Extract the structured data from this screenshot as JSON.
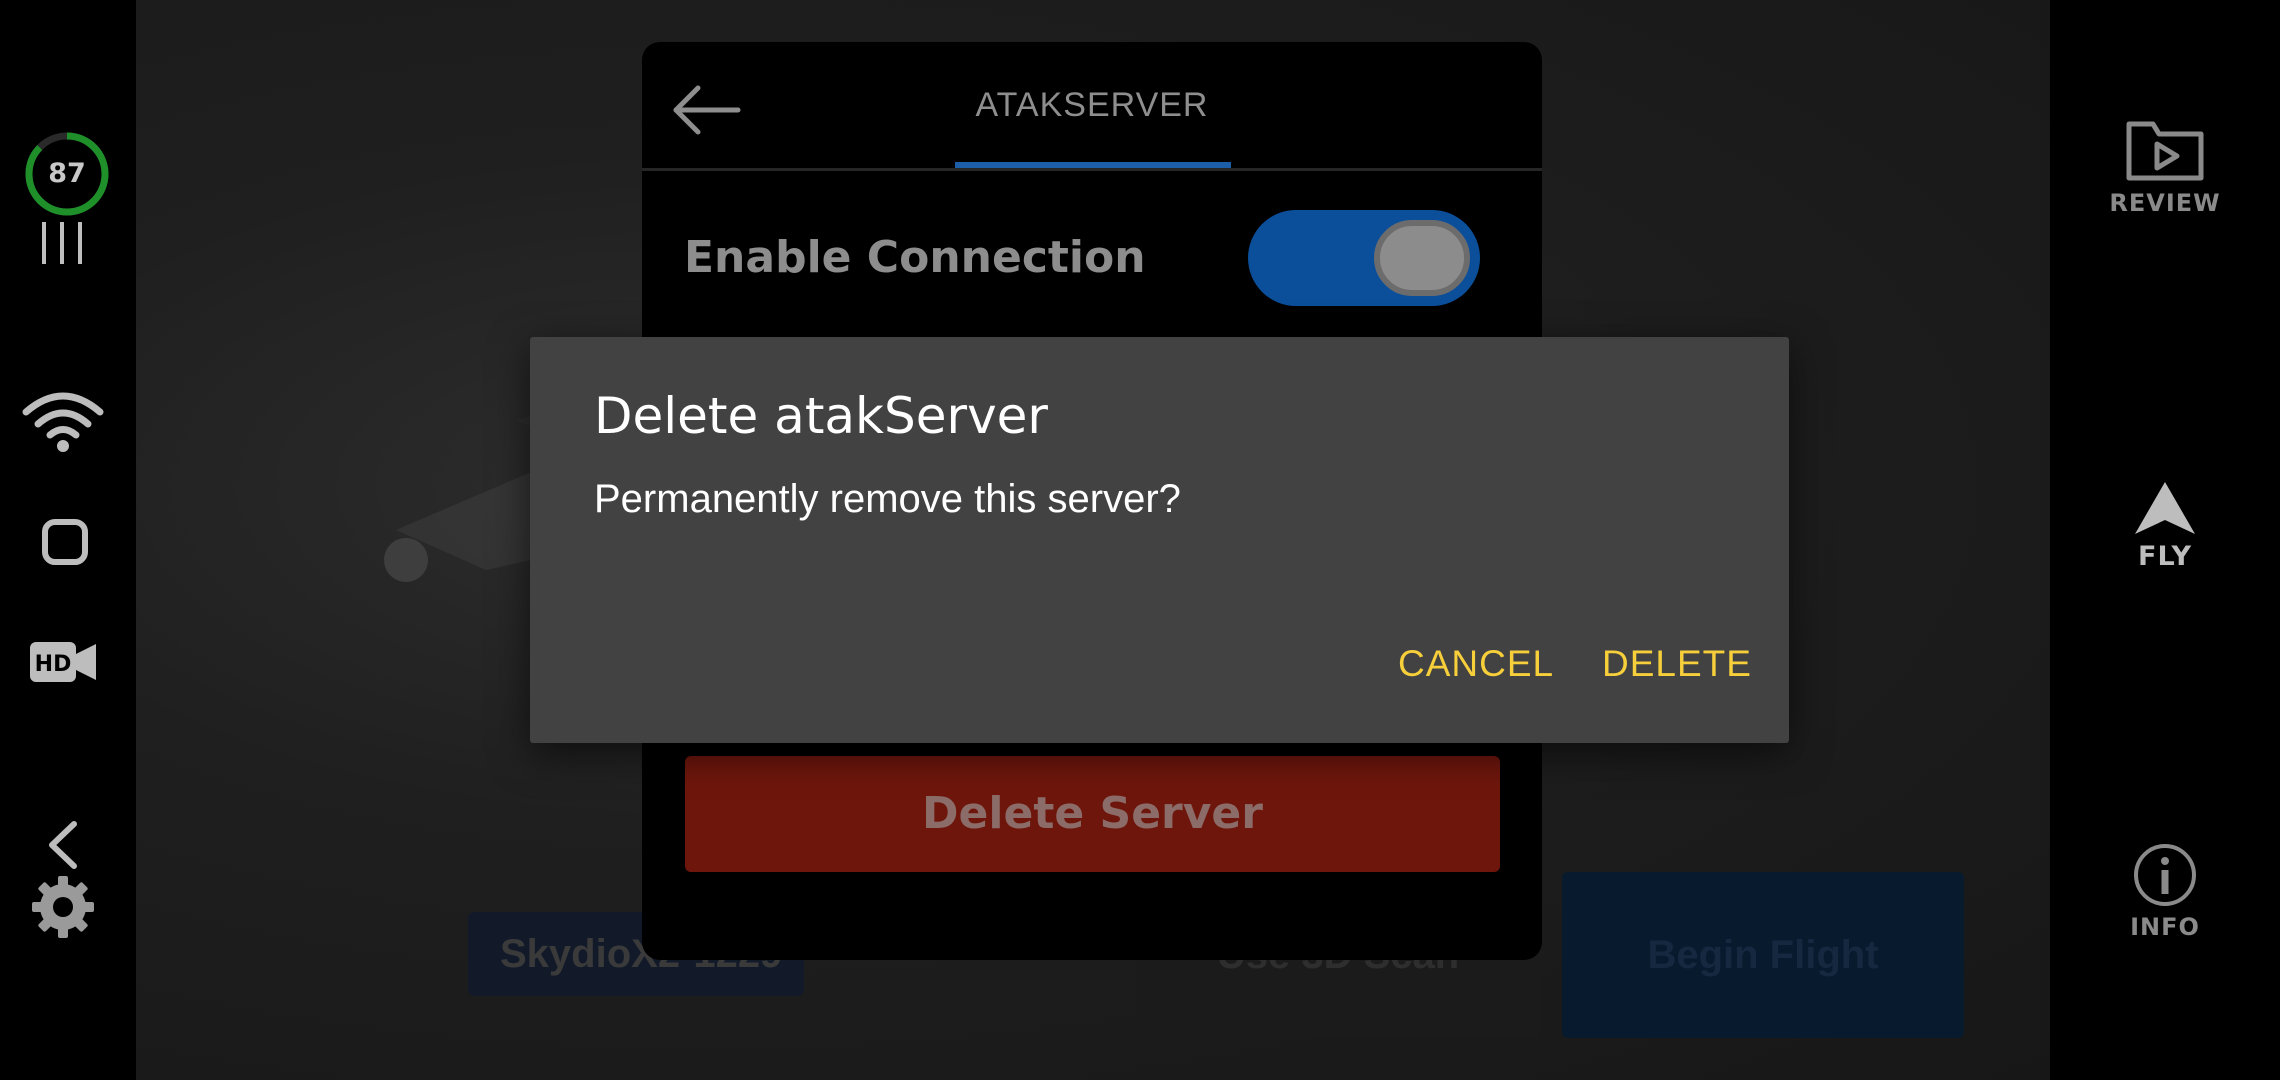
{
  "status": {
    "battery_percent": "87"
  },
  "panel": {
    "title": "ATAKSERVER",
    "enable_connection_label": "Enable Connection",
    "enable_connection_on": true,
    "delete_server_label": "Delete Server"
  },
  "background": {
    "drone_name": "SkydioX2-1229",
    "scan_label": "Use 3D Scan",
    "begin_flight_label": "Begin Flight"
  },
  "right_rail": {
    "review_label": "REVIEW",
    "fly_label": "FLY",
    "info_label": "INFO"
  },
  "dialog": {
    "title": "Delete atakServer",
    "message": "Permanently remove this server?",
    "cancel_label": "CANCEL",
    "delete_label": "DELETE"
  },
  "colors": {
    "accent_yellow": "#f6cf3a",
    "toggle_blue": "#0b4f9b",
    "delete_red": "#6f160c",
    "battery_green": "#1f8f2a"
  },
  "icons": [
    "battery-ring-icon",
    "signal-bars-icon",
    "wifi-icon",
    "square-icon",
    "hd-camera-icon",
    "chevron-left-icon",
    "gear-icon",
    "review-folder-icon",
    "fly-arrow-icon",
    "info-icon",
    "back-arrow-icon"
  ]
}
